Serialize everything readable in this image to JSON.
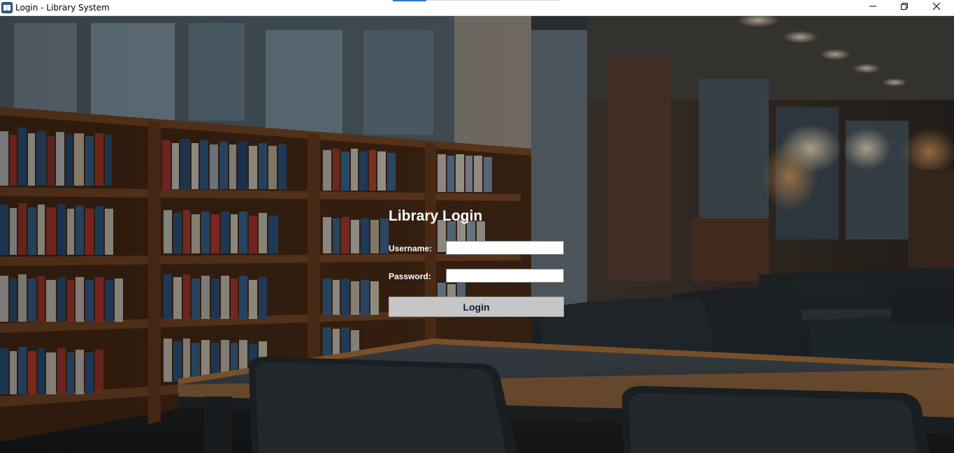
{
  "window": {
    "title": "Login - Library System",
    "icon": "library-app-icon",
    "controls": [
      "minimize-icon",
      "restore-icon",
      "close-icon"
    ]
  },
  "login": {
    "title": "Library Login",
    "username_label": "Username:",
    "username_value": "",
    "password_label": "Password:",
    "password_value": "",
    "button_label": "Login"
  },
  "colors": {
    "button_bg": "#c6c6c6",
    "label_text": "#ffffff",
    "accent": "#2b73d6"
  }
}
